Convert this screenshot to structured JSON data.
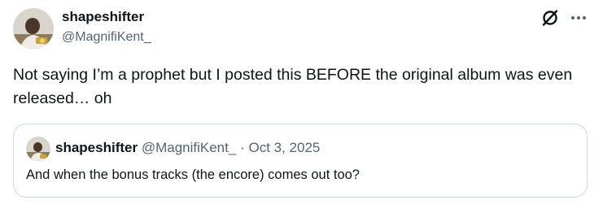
{
  "tweet": {
    "author": {
      "display_name": "shapeshifter",
      "handle": "@MagnifiKent_"
    },
    "text": "Not saying I’m a prophet but I posted this BEFORE the original album was even released… oh",
    "actions": {
      "grok_icon": "grok-icon",
      "more_icon": "more-icon"
    }
  },
  "quoted_tweet": {
    "author": {
      "display_name": "shapeshifter",
      "handle": "@MagnifiKent_"
    },
    "separator": "·",
    "date": "Oct 3, 2025",
    "text": "And when the bonus tracks (the encore) comes out too?"
  },
  "colors": {
    "text_primary": "#0f1419",
    "text_secondary": "#536471",
    "border": "#cfd9de"
  }
}
